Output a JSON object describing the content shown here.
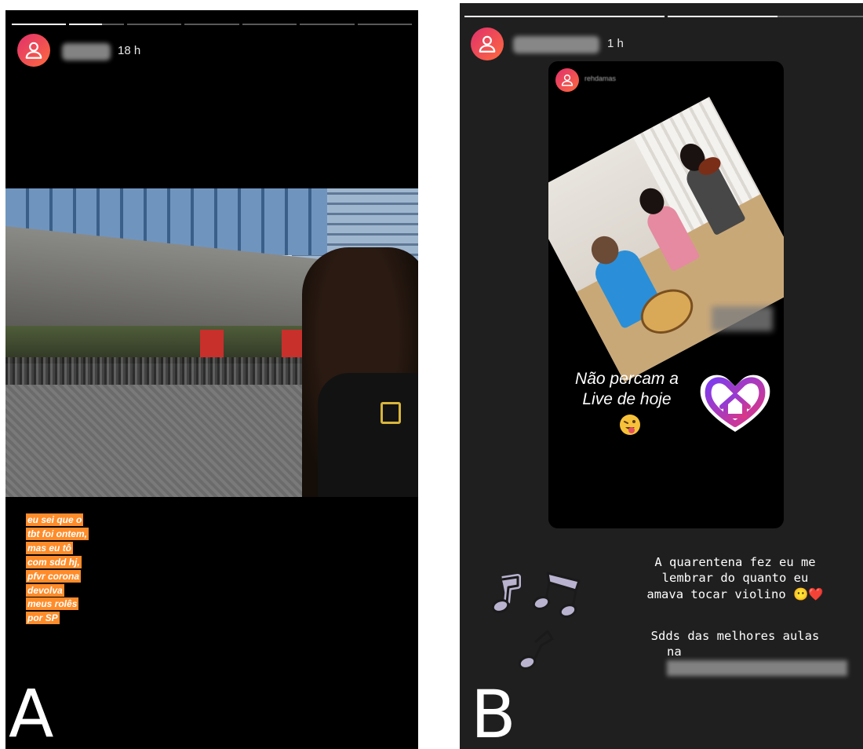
{
  "panels": [
    {
      "letter": "A",
      "timestamp": "18 h",
      "progress_segments": 7,
      "progress_active_index": 1,
      "progress_fill": 0.6,
      "caption_lines": [
        "eu sei que o",
        "tbt foi ontem,",
        "mas eu tô",
        "com sdd hj,",
        "pfvr corona",
        "devolva",
        "meus rolês",
        "por SP"
      ],
      "caption_bg_color": "#ff8c2a",
      "avatar_icon": "user-icon"
    },
    {
      "letter": "B",
      "timestamp": "1 h",
      "progress_segments": 2,
      "progress_active_index": 1,
      "progress_fill": 0.55,
      "shared_post": {
        "username": "rehdamas",
        "text_line1": "Não percam a",
        "text_line2": "Live de hoje",
        "emoji": "tongue-wink-emoji",
        "sticker": "heart-house-icon"
      },
      "caption_line1": "A quarentena fez eu  me",
      "caption_line2": "lembrar do quanto eu",
      "caption_line3": "amava tocar violino 😶❤️",
      "caption_line4": "Sdds das melhores aulas",
      "caption_line5_prefix": "na",
      "decoration": "music-notes-icon",
      "avatar_icon": "user-icon"
    }
  ]
}
